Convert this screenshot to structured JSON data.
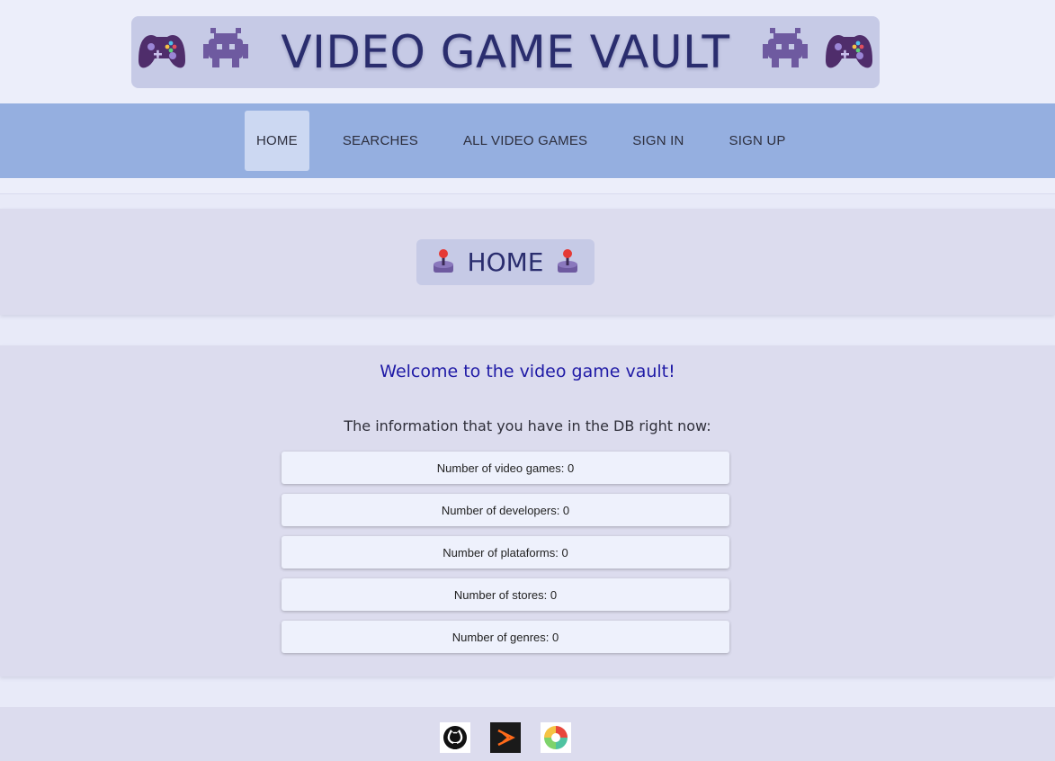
{
  "banner": {
    "title": "VIDEO GAME VAULT",
    "left_icons": [
      "game-controller-icon",
      "space-invader-icon"
    ],
    "right_icons": [
      "space-invader-icon",
      "game-controller-icon"
    ]
  },
  "nav": {
    "items": [
      {
        "label": "HOME",
        "active": true
      },
      {
        "label": "SEARCHES",
        "active": false
      },
      {
        "label": "ALL VIDEO GAMES",
        "active": false
      },
      {
        "label": "SIGN IN",
        "active": false
      },
      {
        "label": "SIGN UP",
        "active": false
      }
    ]
  },
  "home": {
    "title": "HOME",
    "icon": "joystick-icon"
  },
  "info": {
    "welcome": "Welcome to the video game vault!",
    "intro": "The information that you have in the DB right now:",
    "stats": [
      {
        "label": "Number of video games: 0"
      },
      {
        "label": "Number of developers: 0"
      },
      {
        "label": "Number of plataforms: 0"
      },
      {
        "label": "Number of stores: 0"
      },
      {
        "label": "Number of genres: 0"
      }
    ]
  },
  "footer": {
    "links": [
      "github-icon",
      "stackblitz-icon",
      "picsart-icon"
    ]
  },
  "colors": {
    "page_bg": "#e8eaf8",
    "banner_bg": "#c6cae6",
    "title_text": "#2a2d6e",
    "nav_bg": "#95afe0",
    "nav_active_bg": "#ccd8f2",
    "section_bg": "#dcdcee",
    "welcome_text": "#1f1aa6",
    "card_bg": "#eef1fc"
  }
}
